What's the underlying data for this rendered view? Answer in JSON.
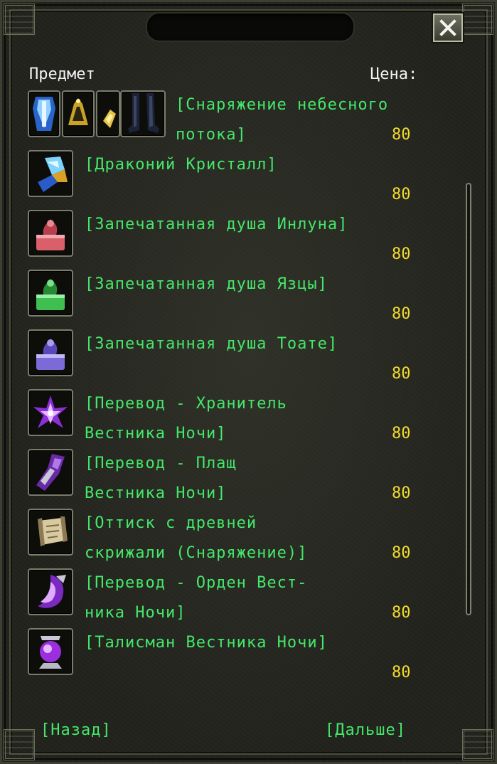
{
  "window": {
    "title": "",
    "close_glyph": "✕"
  },
  "header": {
    "item_label": "Предмет",
    "price_label": "Цена:"
  },
  "items": [
    {
      "name_line1": "[Снаряжение небесного",
      "name_line2": "потока]",
      "price": "80",
      "icon": "armor-set-icon"
    },
    {
      "name_line1": "[Драконий Кристалл]",
      "name_line2": "",
      "price": "80",
      "icon": "dragon-crystal-icon"
    },
    {
      "name_line1": "[Запечатанная душа Инлуна]",
      "name_line2": "",
      "price": "80",
      "icon": "sealed-soul-red-icon"
    },
    {
      "name_line1": "[Запечатанная душа Язцы]",
      "name_line2": "",
      "price": "80",
      "icon": "sealed-soul-green-icon"
    },
    {
      "name_line1": "[Запечатанная душа Тоате]",
      "name_line2": "",
      "price": "80",
      "icon": "sealed-soul-purple-icon"
    },
    {
      "name_line1": "[Перевод - Хранитель",
      "name_line2": "Вестника Ночи]",
      "price": "80",
      "icon": "night-herald-guardian-icon"
    },
    {
      "name_line1": "[Перевод - Плащ",
      "name_line2": "Вестника Ночи]",
      "price": "80",
      "icon": "night-herald-cloak-icon"
    },
    {
      "name_line1": "[Оттиск с древней",
      "name_line2": "скрижали (Снаряжение)]",
      "price": "80",
      "icon": "ancient-tablet-scroll-icon"
    },
    {
      "name_line1": "[Перевод - Орден Вест-",
      "name_line2": "ника Ночи]",
      "price": "80",
      "icon": "night-herald-order-icon"
    },
    {
      "name_line1": "[Талисман Вестника Ночи]",
      "name_line2": "",
      "price": "80",
      "icon": "night-herald-talisman-icon"
    }
  ],
  "footer": {
    "back_label": "[Назад]",
    "next_label": "[Дальше]"
  },
  "colors": {
    "item_text": "#44e86a",
    "price_text": "#f2dc2e",
    "header_text": "#f2f2f2"
  }
}
